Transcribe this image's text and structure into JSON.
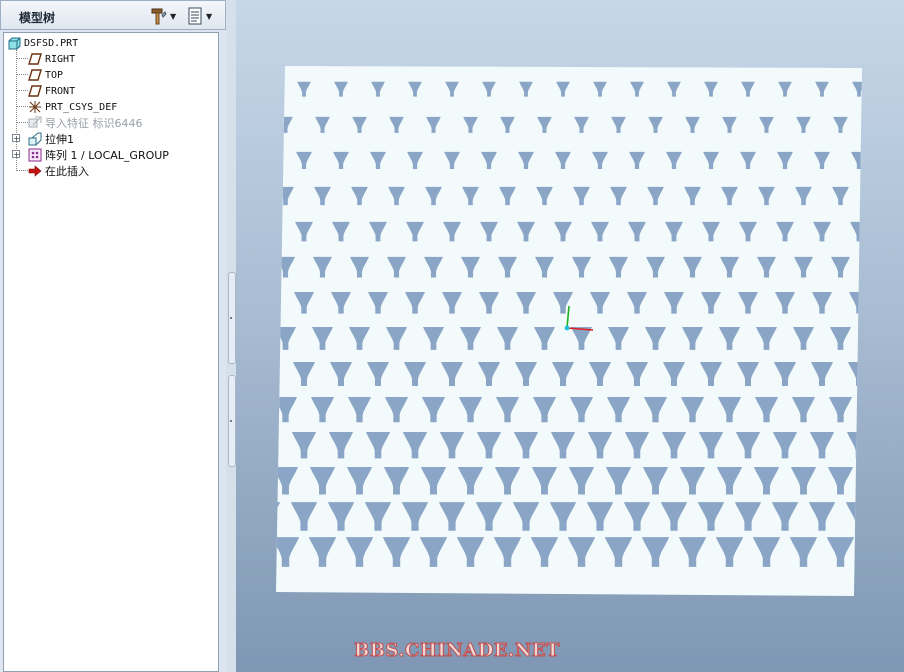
{
  "panel": {
    "title": "模型树",
    "tools_icon": "hammer-wrench-icon",
    "settings_icon": "tree-settings-icon"
  },
  "tree": {
    "items": [
      {
        "label": "DSFSD.PRT",
        "icon": "part-icon"
      },
      {
        "label": "RIGHT",
        "icon": "datum-plane-icon"
      },
      {
        "label": "TOP",
        "icon": "datum-plane-icon"
      },
      {
        "label": "FRONT",
        "icon": "datum-plane-icon"
      },
      {
        "label": "PRT_CSYS_DEF",
        "icon": "csys-icon"
      },
      {
        "label": "导入特征 标识6446",
        "icon": "import-feature-icon"
      },
      {
        "label": "拉伸1",
        "icon": "extrude-icon"
      },
      {
        "label": "阵列 1 / LOCAL_GROUP",
        "icon": "pattern-icon"
      },
      {
        "label": "在此插入",
        "icon": "insert-here-arrow-icon"
      }
    ]
  },
  "viewport": {
    "watermark": "BBS.CHINADE.NET",
    "colors": {
      "plate": "#f3fafb",
      "cutout": "#8aa5c6",
      "x_axis": "#e02020",
      "y_axis": "#20b020",
      "z_axis": "#20c0e0"
    }
  }
}
